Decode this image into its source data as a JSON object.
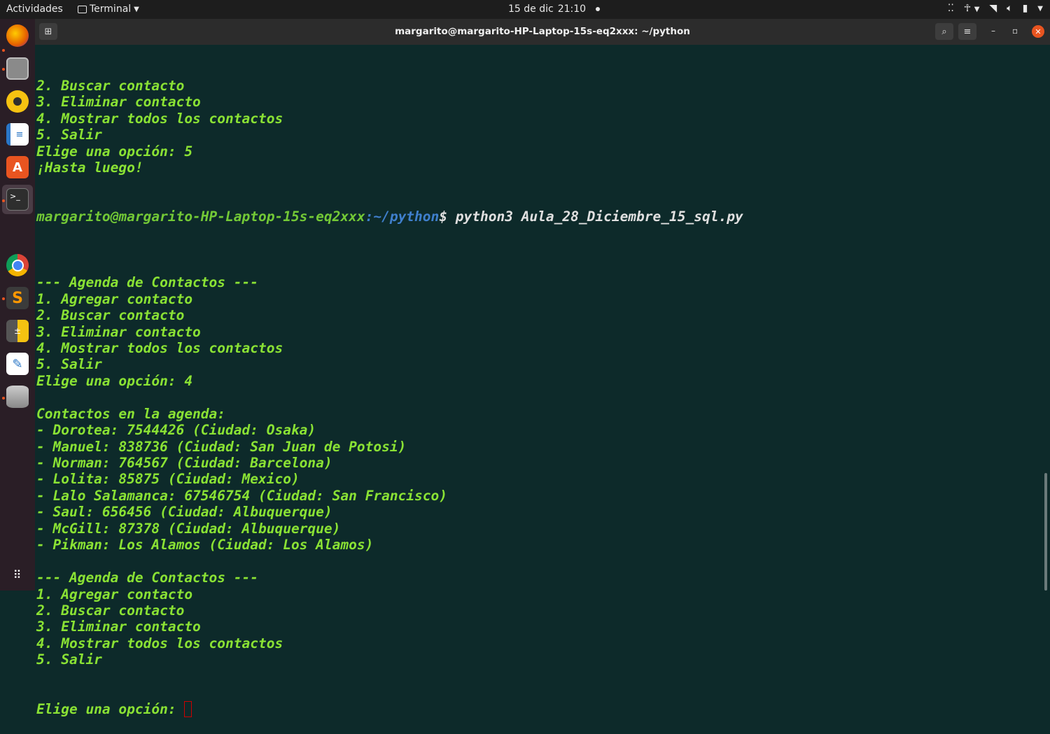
{
  "topbar": {
    "activities": "Actividades",
    "app_name": "Terminal",
    "date": "15 de dic",
    "time": "21:10"
  },
  "dock": {
    "items": [
      {
        "icon": "firefox-icon",
        "color": "#e66000"
      },
      {
        "icon": "files-icon",
        "color": "#9a9a9a"
      },
      {
        "icon": "rhythmbox-icon",
        "color": "#f5c211"
      },
      {
        "icon": "libreoffice-writer-icon",
        "color": "#2a76c6"
      },
      {
        "icon": "software-center-icon",
        "color": "#e95420"
      },
      {
        "icon": "terminal-icon",
        "color": "#2e2e2e"
      },
      {
        "icon": "apps-cluster-icon",
        "color": "#dddddd"
      },
      {
        "icon": "chrome-icon",
        "color": "#4285f4"
      },
      {
        "icon": "sublime-text-icon",
        "color": "#ff9800"
      },
      {
        "icon": "calculator-icon",
        "color": "#f5c211"
      },
      {
        "icon": "text-editor-icon",
        "color": "#ffffff"
      },
      {
        "icon": "database-icon",
        "color": "#aaaaaa"
      }
    ],
    "show_apps_icon": "grid-icon"
  },
  "window": {
    "title": "margarito@margarito-HP-Laptop-15s-eq2xxx: ~/python"
  },
  "terminal": {
    "lines_before": [
      "2. Buscar contacto",
      "3. Eliminar contacto",
      "4. Mostrar todos los contactos",
      "5. Salir",
      "Elige una opción: 5",
      "¡Hasta luego!"
    ],
    "prompt": {
      "user_host": "margarito@margarito-HP-Laptop-15s-eq2xxx",
      "path": ":~/python",
      "symbol": "$",
      "command": " python3 Aula_28_Diciembre_15_sql.py"
    },
    "lines_after": [
      "",
      "--- Agenda de Contactos ---",
      "1. Agregar contacto",
      "2. Buscar contacto",
      "3. Eliminar contacto",
      "4. Mostrar todos los contactos",
      "5. Salir",
      "Elige una opción: 4",
      "",
      "Contactos en la agenda:",
      "- Dorotea: 7544426 (Ciudad: Osaka)",
      "- Manuel: 838736 (Ciudad: San Juan de Potosi)",
      "- Norman: 764567 (Ciudad: Barcelona)",
      "- Lolita: 85875 (Ciudad: Mexico)",
      "- Lalo Salamanca: 67546754 (Ciudad: San Francisco)",
      "- Saul: 656456 (Ciudad: Albuquerque)",
      "- McGill: 87378 (Ciudad: Albuquerque)",
      "- Pikman: Los Alamos (Ciudad: Los Alamos)",
      "",
      "--- Agenda de Contactos ---",
      "1. Agregar contacto",
      "2. Buscar contacto",
      "3. Eliminar contacto",
      "4. Mostrar todos los contactos",
      "5. Salir"
    ],
    "last_prompt": "Elige una opción: "
  }
}
